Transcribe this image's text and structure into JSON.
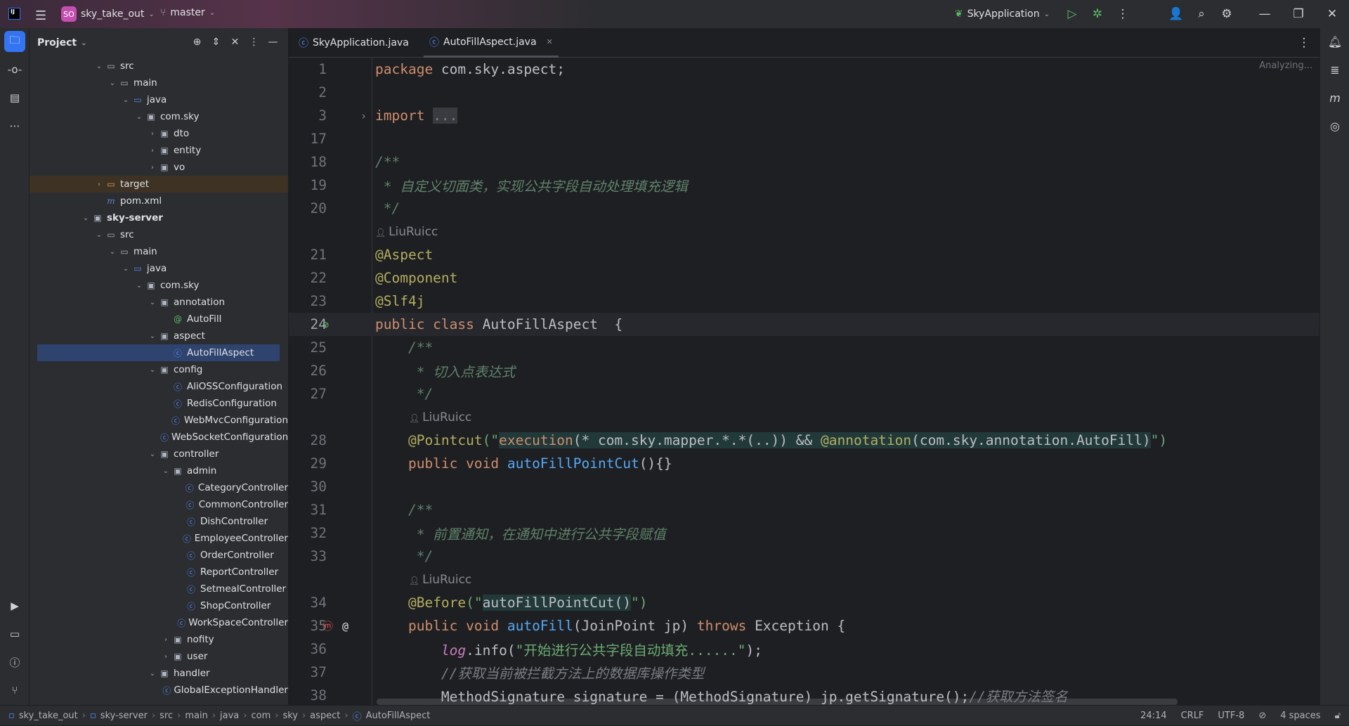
{
  "titlebar": {
    "app_icon": "IJ",
    "project_badge": "SO",
    "project": "sky_take_out",
    "branch": "master",
    "run_config": "SkyApplication"
  },
  "panel": {
    "title": "Project"
  },
  "tree": [
    {
      "label": "src",
      "level": 1,
      "chev": "open",
      "icon": "folder"
    },
    {
      "label": "main",
      "level": 2,
      "chev": "open",
      "icon": "folder"
    },
    {
      "label": "java",
      "level": 3,
      "chev": "open",
      "icon": "src"
    },
    {
      "label": "com.sky",
      "level": 4,
      "chev": "open",
      "icon": "package"
    },
    {
      "label": "dto",
      "level": 5,
      "chev": "closed",
      "icon": "package"
    },
    {
      "label": "entity",
      "level": 5,
      "chev": "closed",
      "icon": "package"
    },
    {
      "label": "vo",
      "level": 5,
      "chev": "closed",
      "icon": "package"
    },
    {
      "label": "target",
      "level": 1,
      "chev": "closed",
      "icon": "target",
      "highlight": true
    },
    {
      "label": "pom.xml",
      "level": 1,
      "chev": "none",
      "icon": "maven"
    },
    {
      "label": "sky-server",
      "level": 0,
      "chev": "open",
      "icon": "module"
    },
    {
      "label": "src",
      "level": 1,
      "chev": "open",
      "icon": "folder"
    },
    {
      "label": "main",
      "level": 2,
      "chev": "open",
      "icon": "folder"
    },
    {
      "label": "java",
      "level": 3,
      "chev": "open",
      "icon": "src"
    },
    {
      "label": "com.sky",
      "level": 4,
      "chev": "open",
      "icon": "package"
    },
    {
      "label": "annotation",
      "level": 5,
      "chev": "open",
      "icon": "package"
    },
    {
      "label": "AutoFill",
      "level": 6,
      "chev": "none",
      "icon": "annotation"
    },
    {
      "label": "aspect",
      "level": 5,
      "chev": "open",
      "icon": "package"
    },
    {
      "label": "AutoFillAspect",
      "level": 6,
      "chev": "none",
      "icon": "class",
      "selected": true
    },
    {
      "label": "config",
      "level": 5,
      "chev": "open",
      "icon": "package"
    },
    {
      "label": "AliOSSConfiguration",
      "level": 6,
      "chev": "none",
      "icon": "class"
    },
    {
      "label": "RedisConfiguration",
      "level": 6,
      "chev": "none",
      "icon": "class"
    },
    {
      "label": "WebMvcConfiguration",
      "level": 6,
      "chev": "none",
      "icon": "class"
    },
    {
      "label": "WebSocketConfiguration",
      "level": 6,
      "chev": "none",
      "icon": "class"
    },
    {
      "label": "controller",
      "level": 5,
      "chev": "open",
      "icon": "package"
    },
    {
      "label": "admin",
      "level": 6,
      "chev": "open",
      "icon": "package"
    },
    {
      "label": "CategoryController",
      "level": 7,
      "chev": "none",
      "icon": "class"
    },
    {
      "label": "CommonController",
      "level": 7,
      "chev": "none",
      "icon": "class"
    },
    {
      "label": "DishController",
      "level": 7,
      "chev": "none",
      "icon": "class"
    },
    {
      "label": "EmployeeController",
      "level": 7,
      "chev": "none",
      "icon": "class"
    },
    {
      "label": "OrderController",
      "level": 7,
      "chev": "none",
      "icon": "class"
    },
    {
      "label": "ReportController",
      "level": 7,
      "chev": "none",
      "icon": "class"
    },
    {
      "label": "SetmealController",
      "level": 7,
      "chev": "none",
      "icon": "class"
    },
    {
      "label": "ShopController",
      "level": 7,
      "chev": "none",
      "icon": "class"
    },
    {
      "label": "WorkSpaceController",
      "level": 7,
      "chev": "none",
      "icon": "class"
    },
    {
      "label": "nofity",
      "level": 6,
      "chev": "closed",
      "icon": "package"
    },
    {
      "label": "user",
      "level": 6,
      "chev": "closed",
      "icon": "package"
    },
    {
      "label": "handler",
      "level": 5,
      "chev": "open",
      "icon": "package"
    },
    {
      "label": "GlobalExceptionHandler",
      "level": 6,
      "chev": "none",
      "icon": "class"
    }
  ],
  "tabs": [
    {
      "label": "SkyApplication.java",
      "active": false
    },
    {
      "label": "AutoFillAspect.java",
      "active": true
    }
  ],
  "editor": {
    "status": "Analyzing...",
    "lines": [
      {
        "n": "1",
        "seg": [
          [
            "package ",
            "k"
          ],
          [
            "com.sky.aspect;",
            "t"
          ]
        ]
      },
      {
        "n": "2",
        "seg": []
      },
      {
        "n": "3",
        "seg": [
          [
            "import ",
            "k"
          ],
          [
            "...",
            "fold"
          ]
        ],
        "fold": true
      },
      {
        "n": "17",
        "seg": []
      },
      {
        "n": "18",
        "seg": [
          [
            "/**",
            "dc"
          ]
        ]
      },
      {
        "n": "19",
        "seg": [
          [
            " * 自定义切面类，实现公共字段自动处理填充逻辑",
            "dc"
          ]
        ]
      },
      {
        "n": "20",
        "seg": [
          [
            " */",
            "dc"
          ]
        ]
      },
      {
        "n": "",
        "hint": "LiuRuicc",
        "indent": 0
      },
      {
        "n": "21",
        "seg": [
          [
            "@Aspect",
            "a"
          ]
        ]
      },
      {
        "n": "22",
        "seg": [
          [
            "@Component",
            "a"
          ]
        ]
      },
      {
        "n": "23",
        "seg": [
          [
            "@Slf4j",
            "a"
          ]
        ]
      },
      {
        "n": "24",
        "seg": [
          [
            "public class ",
            "k"
          ],
          [
            "AutoFillAspect  {",
            "t"
          ]
        ],
        "current": true,
        "gutter": "spring-bean-icon"
      },
      {
        "n": "25",
        "seg": [
          [
            "    /**",
            "dc"
          ]
        ]
      },
      {
        "n": "26",
        "seg": [
          [
            "     * 切入点表达式",
            "dc"
          ]
        ]
      },
      {
        "n": "27",
        "seg": [
          [
            "     */",
            "dc"
          ]
        ]
      },
      {
        "n": "",
        "hint": "LiuRuicc",
        "indent": 4
      },
      {
        "n": "28",
        "seg": [
          [
            "    ",
            "t"
          ],
          [
            "@Pointcut",
            "a"
          ],
          [
            "(\"",
            "s"
          ],
          [
            "execution",
            "k inj"
          ],
          [
            "(* com.sky.mapper.*.*(..)) && ",
            "t inj"
          ],
          [
            "@annotation",
            "a inj"
          ],
          [
            "(com.sky.annotation.AutoFill)",
            "t inj"
          ],
          [
            "\")",
            "s"
          ]
        ]
      },
      {
        "n": "29",
        "seg": [
          [
            "    public void ",
            "k"
          ],
          [
            "autoFillPointCut",
            "m"
          ],
          [
            "(){}",
            "t"
          ]
        ]
      },
      {
        "n": "30",
        "seg": []
      },
      {
        "n": "31",
        "seg": [
          [
            "    /**",
            "dc"
          ]
        ]
      },
      {
        "n": "32",
        "seg": [
          [
            "     * 前置通知，在通知中进行公共字段赋值",
            "dc"
          ]
        ]
      },
      {
        "n": "33",
        "seg": [
          [
            "     */",
            "dc"
          ]
        ]
      },
      {
        "n": "",
        "hint": "LiuRuicc",
        "indent": 4
      },
      {
        "n": "34",
        "seg": [
          [
            "    ",
            "t"
          ],
          [
            "@Before",
            "a"
          ],
          [
            "(\"",
            "s"
          ],
          [
            "autoFillPointCut()",
            "t inj"
          ],
          [
            "\")",
            "s"
          ]
        ]
      },
      {
        "n": "35",
        "seg": [
          [
            "    public void ",
            "k"
          ],
          [
            "autoFill",
            "m"
          ],
          [
            "(JoinPoint jp) ",
            "t"
          ],
          [
            "throws ",
            "k"
          ],
          [
            "Exception {",
            "t"
          ]
        ],
        "gutter": "method-advice-icon"
      },
      {
        "n": "36",
        "seg": [
          [
            "        ",
            "t"
          ],
          [
            "log",
            "f"
          ],
          [
            ".info(",
            "t"
          ],
          [
            "\"开始进行公共字段自动填充......\"",
            "s"
          ],
          [
            ");",
            "t"
          ]
        ]
      },
      {
        "n": "37",
        "seg": [
          [
            "        //获取当前被拦截方法上的数据库操作类型",
            "lc"
          ]
        ]
      },
      {
        "n": "38",
        "seg": [
          [
            "        MethodSignature signature = (MethodSignature) jp.getSignature();",
            "t"
          ],
          [
            "//获取方法签名",
            "lc"
          ]
        ]
      }
    ]
  },
  "statusbar": {
    "crumbs": [
      "sky_take_out",
      "sky-server",
      "src",
      "main",
      "java",
      "com",
      "sky",
      "aspect",
      "AutoFillAspect"
    ],
    "position": "24:14",
    "line_ending": "CRLF",
    "encoding": "UTF-8",
    "indent": "4 spaces"
  }
}
